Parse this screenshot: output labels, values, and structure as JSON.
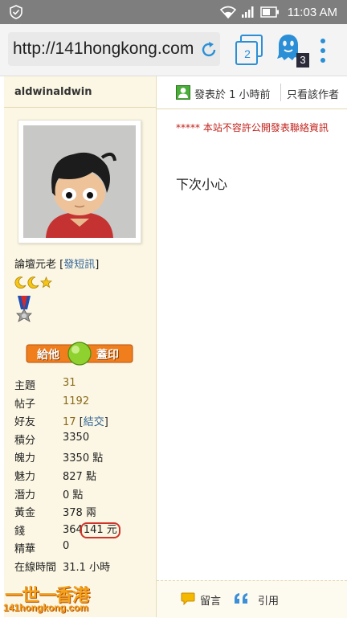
{
  "status_bar": {
    "time": "11:03 AM"
  },
  "browser": {
    "url": "http://141hongkong.com",
    "tab_count": "2",
    "ghost_badge": "3"
  },
  "post": {
    "author": "aldwinaldwin",
    "rank": "論壇元老",
    "pm_link": "發短訊",
    "stamp_label": "給他 蓋印",
    "stats": [
      {
        "label": "主題",
        "value": "31"
      },
      {
        "label": "帖子",
        "value": "1192"
      },
      {
        "label": "好友",
        "value": "17",
        "link": "結交"
      },
      {
        "label": "積分",
        "value": "3350"
      },
      {
        "label": "魄力",
        "value": "3350 點"
      },
      {
        "label": "魅力",
        "value": "827 點"
      },
      {
        "label": "潛力",
        "value": "0 點"
      },
      {
        "label": "黃金",
        "value": "378 兩"
      },
      {
        "label": "錢",
        "value_prefix": "364",
        "value_boxed": "141",
        "value_suffix": "元"
      },
      {
        "label": "精華",
        "value": "0"
      },
      {
        "label": "在線時間",
        "value": "31.1 小時"
      }
    ],
    "posted_time": "發表於 1 小時前",
    "only_author": "只看該作者",
    "notice": "***** 本站不容許公開發表聯絡資訊",
    "body": "下次小心",
    "footer": {
      "reply_label": "留言",
      "quote_label": "引用"
    }
  },
  "watermark": {
    "title": "一世一香港",
    "site": "141hongkong.com"
  },
  "colors": {
    "status_bar": "#7e7e7e",
    "accent_blue": "#2a8fd6",
    "sidebar_bg": "#fcf7e4",
    "notice_red": "#c0201a"
  }
}
